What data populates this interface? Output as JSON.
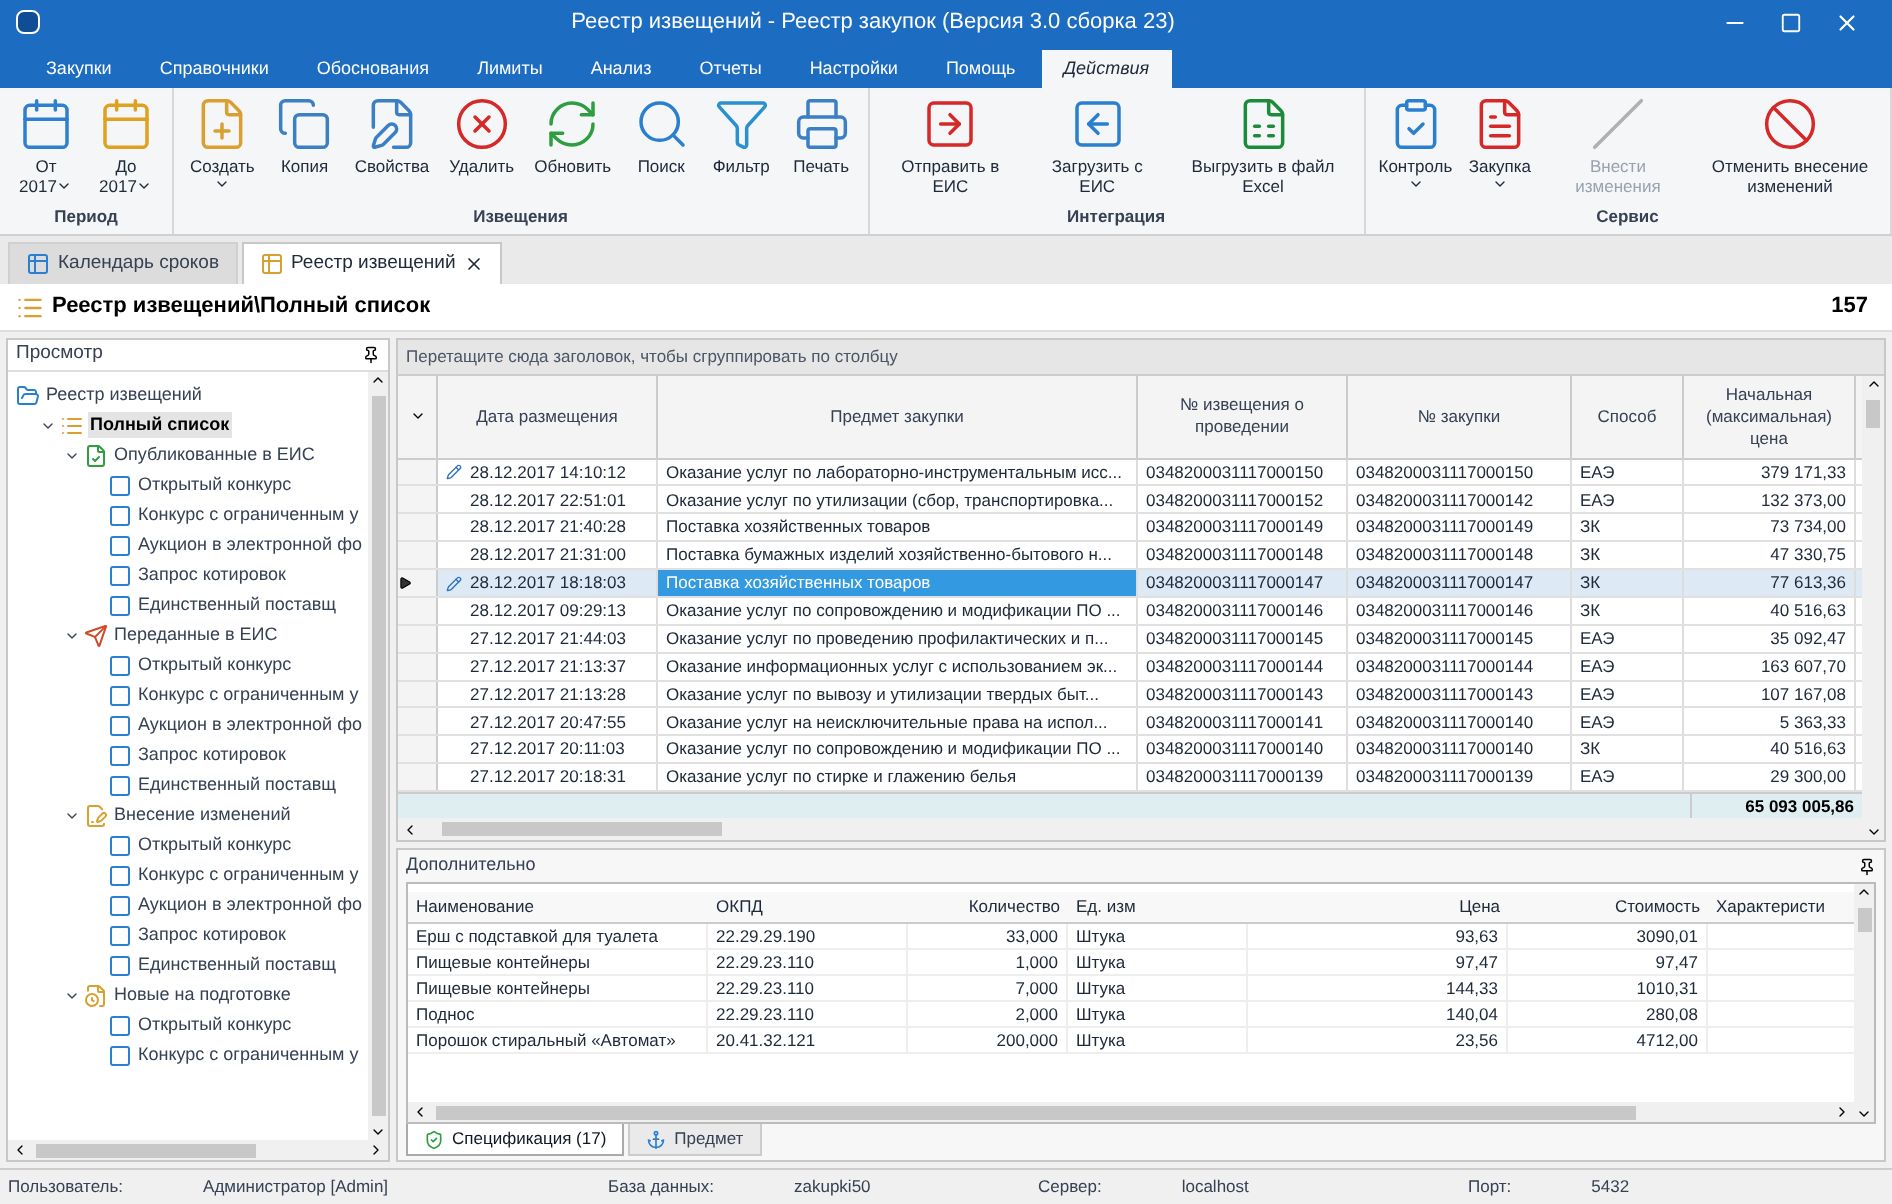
{
  "window": {
    "title": "Реестр извещений - Реестр закупок (Версия 3.0 сборка 23)"
  },
  "ribbon_tabs": [
    {
      "label": "Закупки",
      "selected": false
    },
    {
      "label": "Справочники",
      "selected": false
    },
    {
      "label": "Обоснования",
      "selected": false
    },
    {
      "label": "Лимиты",
      "selected": false
    },
    {
      "label": "Анализ",
      "selected": false
    },
    {
      "label": "Отчеты",
      "selected": false
    },
    {
      "label": "Настройки",
      "selected": false
    },
    {
      "label": "Помощь",
      "selected": false
    },
    {
      "label": "Действия",
      "selected": true
    }
  ],
  "ribbon_groups": [
    {
      "label": "Период",
      "buttons": [
        {
          "label": "От",
          "sub": "2017",
          "dropdown": true,
          "disabled": false
        },
        {
          "label": "До",
          "sub": "2017",
          "dropdown": true,
          "disabled": false
        }
      ]
    },
    {
      "label": "Извещения",
      "buttons": [
        {
          "label": "Создать",
          "dropdown": true,
          "disabled": false
        },
        {
          "label": "Копия",
          "dropdown": false,
          "disabled": false
        },
        {
          "label": "Свойства",
          "dropdown": false,
          "disabled": false
        },
        {
          "label": "Удалить",
          "dropdown": false,
          "disabled": false
        },
        {
          "label": "Обновить",
          "dropdown": false,
          "disabled": false
        },
        {
          "label": "Поиск",
          "dropdown": false,
          "disabled": false
        },
        {
          "label": "Фильтр",
          "dropdown": false,
          "disabled": false
        },
        {
          "label": "Печать",
          "dropdown": false,
          "disabled": false
        }
      ]
    },
    {
      "label": "Интеграция",
      "buttons": [
        {
          "label": "Отправить в ЕИС",
          "dropdown": false,
          "disabled": false
        },
        {
          "label": "Загрузить с ЕИС",
          "dropdown": false,
          "disabled": false
        },
        {
          "label": "Выгрузить в файл Excel",
          "dropdown": false,
          "disabled": false
        }
      ]
    },
    {
      "label": "Сервис",
      "buttons": [
        {
          "label": "Контроль",
          "dropdown": true,
          "disabled": false
        },
        {
          "label": "Закупка",
          "dropdown": true,
          "disabled": false
        },
        {
          "label": "Внести изменения",
          "dropdown": false,
          "disabled": true
        },
        {
          "label": "Отменить внесение изменений",
          "dropdown": false,
          "disabled": false
        }
      ]
    }
  ],
  "doc_tabs": [
    {
      "label": "Календарь сроков",
      "selected": false
    },
    {
      "label": "Реестр извещений",
      "selected": true
    }
  ],
  "header": {
    "title": "Реестр извещений\\Полный список",
    "count": "157"
  },
  "sidebar": {
    "title": "Просмотр",
    "tree": [
      {
        "label": "Реестр извещений",
        "expanded": true,
        "selected": false,
        "children": [
          {
            "label": "Полный список",
            "expanded": true,
            "selected": true,
            "children": [
              {
                "label": "Опубликованные в ЕИС",
                "expanded": true,
                "selected": false,
                "children": [
                  {
                    "label": "Открытый конкурс",
                    "selected": false
                  },
                  {
                    "label": "Конкурс с ограниченным у",
                    "selected": false
                  },
                  {
                    "label": "Аукцион в электронной фо",
                    "selected": false
                  },
                  {
                    "label": "Запрос котировок",
                    "selected": false
                  },
                  {
                    "label": "Единственный поставщ",
                    "selected": false
                  }
                ]
              },
              {
                "label": "Переданные в ЕИС",
                "expanded": true,
                "selected": false,
                "children": [
                  {
                    "label": "Открытый конкурс",
                    "selected": false
                  },
                  {
                    "label": "Конкурс с ограниченным у",
                    "selected": false
                  },
                  {
                    "label": "Аукцион в электронной фо",
                    "selected": false
                  },
                  {
                    "label": "Запрос котировок",
                    "selected": false
                  },
                  {
                    "label": "Единственный поставщ",
                    "selected": false
                  }
                ]
              },
              {
                "label": "Внесение изменений",
                "expanded": true,
                "selected": false,
                "children": [
                  {
                    "label": "Открытый конкурс",
                    "selected": false
                  },
                  {
                    "label": "Конкурс с ограниченным у",
                    "selected": false
                  },
                  {
                    "label": "Аукцион в электронной фо",
                    "selected": false
                  },
                  {
                    "label": "Запрос котировок",
                    "selected": false
                  },
                  {
                    "label": "Единственный поставщ",
                    "selected": false
                  }
                ]
              },
              {
                "label": "Новые на подготовке",
                "expanded": true,
                "selected": false,
                "children": [
                  {
                    "label": "Открытый конкурс",
                    "selected": false
                  },
                  {
                    "label": "Конкурс с ограниченным у",
                    "selected": false
                  }
                ]
              }
            ]
          }
        ]
      }
    ]
  },
  "grid": {
    "group_hint": "Перетащите сюда заголовок, чтобы сгруппировать по столбцу",
    "columns": [
      "Дата размещения",
      "Предмет закупки",
      "№ извещения о проведении",
      "№ закупки",
      "Способ",
      "Начальная (максимальная) цена"
    ],
    "rows": [
      {
        "modified": true,
        "selected": false,
        "cells": [
          "28.12.2017 14:10:12",
          "Оказание услуг по лабораторно-инструментальным исс...",
          "0348200031117000150",
          "0348200031117000150",
          "ЕАЭ",
          "379 171,33"
        ]
      },
      {
        "modified": false,
        "selected": false,
        "cells": [
          "28.12.2017 22:51:01",
          "Оказание услуг по утилизации (сбор, транспортировка...",
          "0348200031117000152",
          "0348200031117000142",
          "ЕАЭ",
          "132 373,00"
        ]
      },
      {
        "modified": false,
        "selected": false,
        "cells": [
          "28.12.2017 21:40:28",
          "Поставка хозяйственных товаров",
          "0348200031117000149",
          "0348200031117000149",
          "ЗК",
          "73 734,00"
        ]
      },
      {
        "modified": false,
        "selected": false,
        "cells": [
          "28.12.2017 21:31:00",
          "Поставка бумажных изделий хозяйственно-бытового н...",
          "0348200031117000148",
          "0348200031117000148",
          "ЗК",
          "47 330,75"
        ]
      },
      {
        "modified": true,
        "selected": true,
        "cells": [
          "28.12.2017 18:18:03",
          "Поставка хозяйственных товаров",
          "0348200031117000147",
          "0348200031117000147",
          "ЗК",
          "77 613,36"
        ]
      },
      {
        "modified": false,
        "selected": false,
        "cells": [
          "28.12.2017 09:29:13",
          "Оказание услуг по сопровождению и модификации ПО ...",
          "0348200031117000146",
          "0348200031117000146",
          "ЗК",
          "40 516,63"
        ]
      },
      {
        "modified": false,
        "selected": false,
        "cells": [
          "27.12.2017 21:44:03",
          "Оказание услуг по проведению профилактических и п...",
          "0348200031117000145",
          "0348200031117000145",
          "ЕАЭ",
          "35 092,47"
        ]
      },
      {
        "modified": false,
        "selected": false,
        "cells": [
          "27.12.2017 21:13:37",
          "Оказание информационных услуг с использованием эк...",
          "0348200031117000144",
          "0348200031117000144",
          "ЕАЭ",
          "163 607,70"
        ]
      },
      {
        "modified": false,
        "selected": false,
        "cells": [
          "27.12.2017 21:13:28",
          "Оказание услуг по вывозу и утилизации твердых быт...",
          "0348200031117000143",
          "0348200031117000143",
          "ЕАЭ",
          "107 167,08"
        ]
      },
      {
        "modified": false,
        "selected": false,
        "cells": [
          "27.12.2017 20:47:55",
          "Оказание услуг на неисключительные права на испол...",
          "0348200031117000141",
          "0348200031117000140",
          "ЕАЭ",
          "5 363,33"
        ]
      },
      {
        "modified": false,
        "selected": false,
        "cells": [
          "27.12.2017 20:11:03",
          "Оказание услуг по сопровождению и модификации ПО ...",
          "0348200031117000140",
          "0348200031117000140",
          "ЗК",
          "40 516,63"
        ]
      },
      {
        "modified": false,
        "selected": false,
        "cells": [
          "27.12.2017 20:18:31",
          "Оказание услуг по стирке и глажению белья",
          "0348200031117000139",
          "0348200031117000139",
          "ЕАЭ",
          "29 300,00"
        ]
      }
    ],
    "total": "65 093 005,86"
  },
  "details": {
    "title": "Дополнительно",
    "columns": [
      "Наименование",
      "ОКПД",
      "Количество",
      "Ед. изм",
      "Цена",
      "Стоимость",
      "Характеристи"
    ],
    "rows": [
      [
        "Ерш с подставкой для туалета",
        "22.29.29.190",
        "33,000",
        "Штука",
        "93,63",
        "3090,01"
      ],
      [
        "Пищевые контейнеры",
        "22.29.23.110",
        "1,000",
        "Штука",
        "97,47",
        "97,47"
      ],
      [
        "Пищевые контейнеры",
        "22.29.23.110",
        "7,000",
        "Штука",
        "144,33",
        "1010,31"
      ],
      [
        "Поднос",
        "22.29.23.110",
        "2,000",
        "Штука",
        "140,04",
        "280,08"
      ],
      [
        "Порошок стиральный «Автомат»",
        "20.41.32.121",
        "200,000",
        "Штука",
        "23,56",
        "4712,00"
      ]
    ],
    "tabs": [
      {
        "label": "Спецификация (17)",
        "selected": true
      },
      {
        "label": "Предмет",
        "selected": false
      }
    ]
  },
  "status_bar": [
    {
      "label": "Пользователь:",
      "value": "Администратор [Admin]"
    },
    {
      "label": "База данных:",
      "value": "zakupki50"
    },
    {
      "label": "Сервер:",
      "value": "localhost"
    },
    {
      "label": "Порт:",
      "value": "5432"
    }
  ]
}
